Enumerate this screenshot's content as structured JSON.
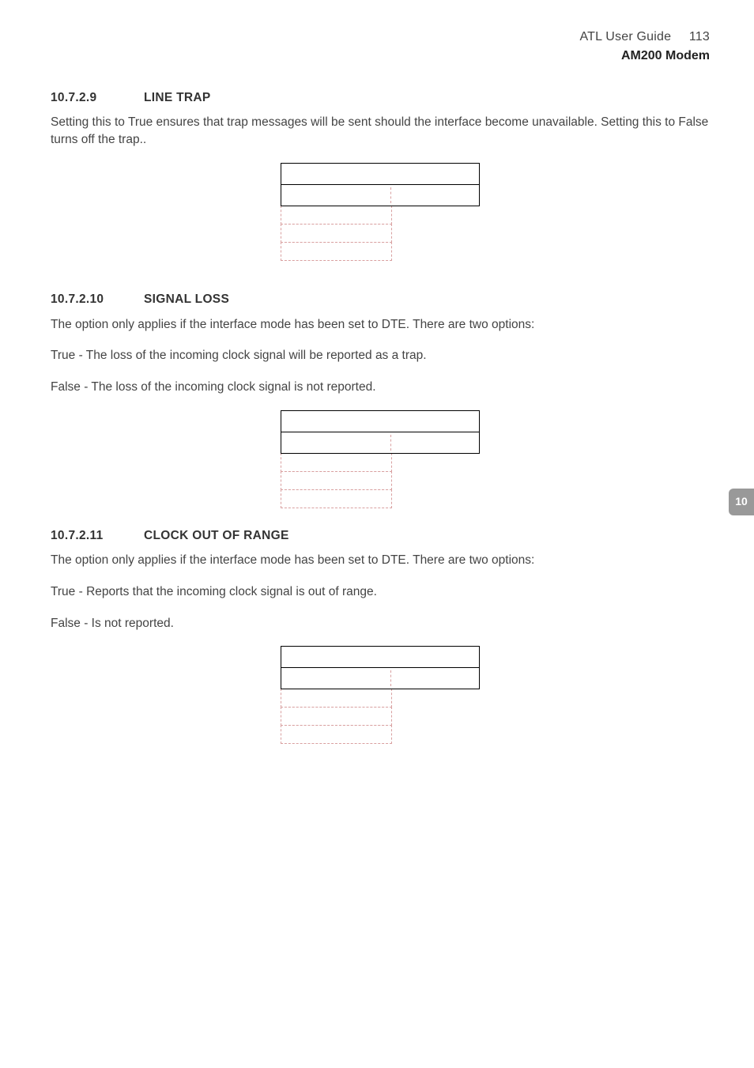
{
  "header": {
    "guide": "ATL User Guide",
    "page_number": "113",
    "product": "AM200 Modem"
  },
  "side_tab": {
    "label": "10"
  },
  "sections": {
    "s1": {
      "number": "10.7.2.9",
      "title": "LINE TRAP",
      "para": "Setting this to True ensures that trap messages will be sent should the interface become unavailable. Setting this to False turns off the trap.."
    },
    "s2": {
      "number": "10.7.2.10",
      "title": "SIGNAL LOSS",
      "intro": "The option only applies if the interface mode has been set to DTE. There are two options:",
      "opt_true": "True - The loss of the incoming clock signal will be reported as a trap.",
      "opt_false": "False - The loss of the incoming clock signal is not reported."
    },
    "s3": {
      "number": "10.7.2.11",
      "title": "CLOCK OUT OF RANGE",
      "intro": "The option only applies if the interface mode has been set to DTE. There are two options:",
      "opt_true": "True - Reports that the incoming clock signal is out of range.",
      "opt_false": "False - Is not reported."
    }
  }
}
